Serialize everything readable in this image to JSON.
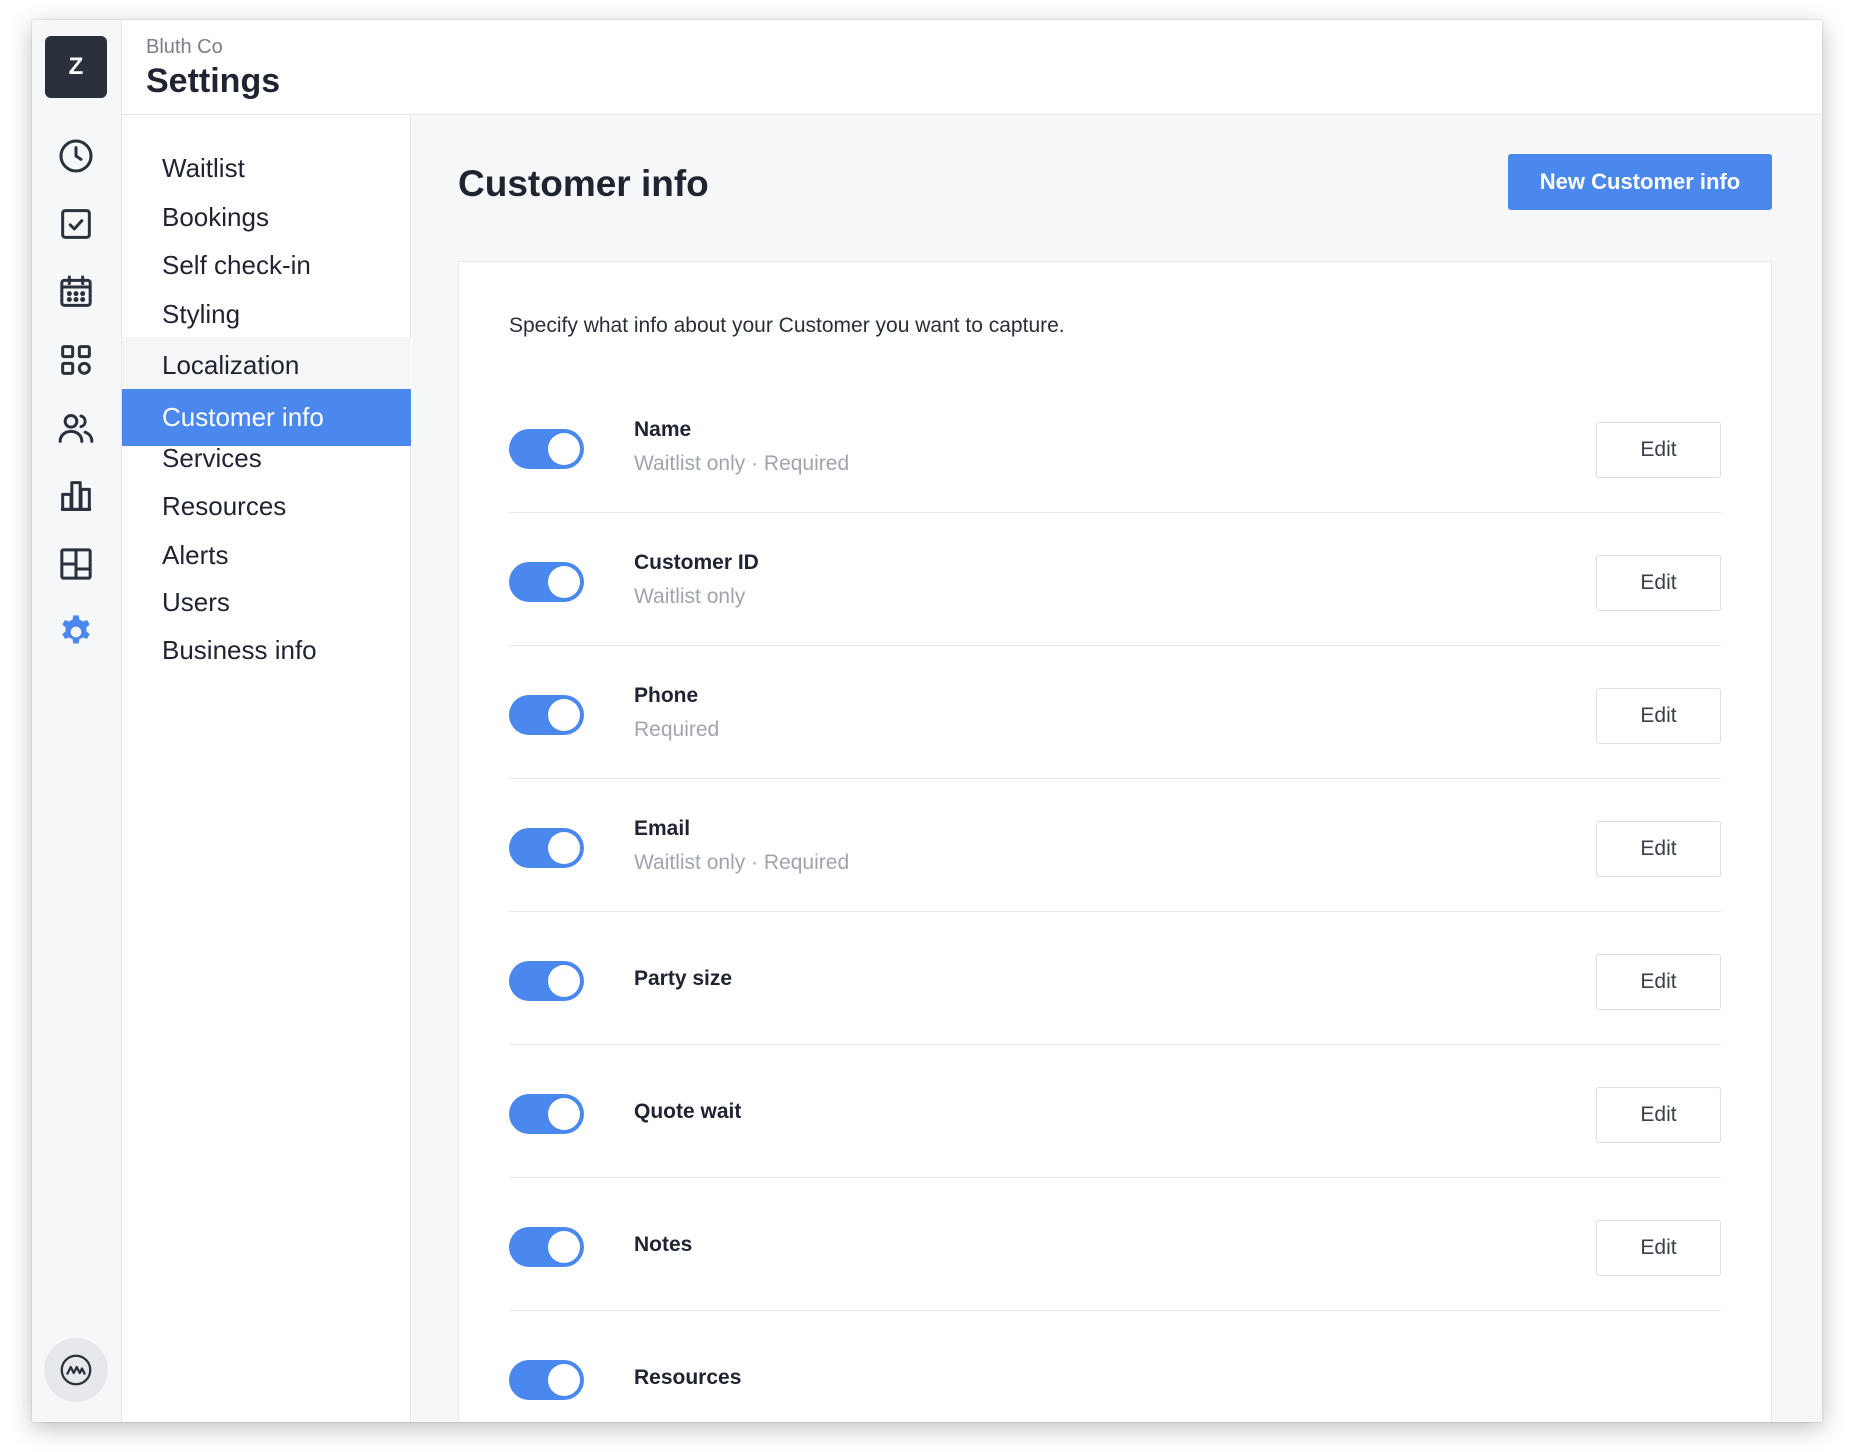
{
  "app": {
    "logo_letter": "Z",
    "org_name": "Bluth Co",
    "page_title": "Settings"
  },
  "rail_icons": [
    "clock-icon",
    "checkbox-icon",
    "calendar-icon",
    "grid-icon",
    "users-icon",
    "bar-chart-icon",
    "layout-icon",
    "gear-icon"
  ],
  "subnav": {
    "items": [
      {
        "label": "Waitlist"
      },
      {
        "label": "Bookings"
      },
      {
        "label": "Self check-in"
      },
      {
        "label": "Styling"
      },
      {
        "label": "Localization"
      },
      {
        "label": "Customer info"
      },
      {
        "label": "Services"
      },
      {
        "label": "Resources"
      },
      {
        "label": "Alerts"
      },
      {
        "label": "Users"
      },
      {
        "label": "Business info"
      }
    ],
    "active": "Customer info"
  },
  "main": {
    "title": "Customer info",
    "new_button_label": "New Customer info",
    "description": "Specify what info about your Customer you want to capture.",
    "fields": [
      {
        "name": "Name",
        "meta": "Waitlist only · Required",
        "enabled": true,
        "edit_label": "Edit"
      },
      {
        "name": "Customer ID",
        "meta": "Waitlist only",
        "enabled": true,
        "edit_label": "Edit"
      },
      {
        "name": "Phone",
        "meta": "Required",
        "enabled": true,
        "edit_label": "Edit"
      },
      {
        "name": "Email",
        "meta": "Waitlist only · Required",
        "enabled": true,
        "edit_label": "Edit"
      },
      {
        "name": "Party size",
        "meta": "",
        "enabled": true,
        "edit_label": "Edit"
      },
      {
        "name": "Quote wait",
        "meta": "",
        "enabled": true,
        "edit_label": "Edit"
      },
      {
        "name": "Notes",
        "meta": "",
        "enabled": true,
        "edit_label": "Edit"
      },
      {
        "name": "Resources",
        "meta": "",
        "enabled": true,
        "edit_label": ""
      }
    ]
  },
  "colors": {
    "accent": "#4a88ee",
    "dark": "#2a313c"
  }
}
